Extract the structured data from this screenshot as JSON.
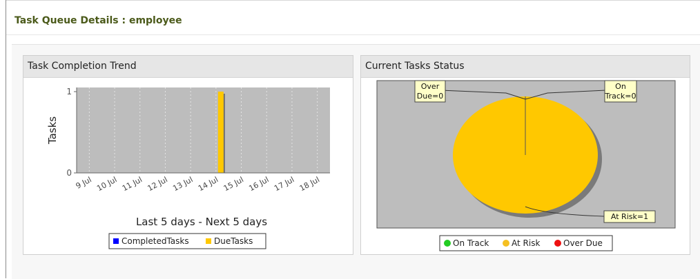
{
  "page": {
    "title": "Task Queue Details : employee"
  },
  "trend_panel": {
    "title": "Task Completion Trend",
    "legend": [
      {
        "label": "CompletedTasks",
        "color": "#0000ff"
      },
      {
        "label": "DueTasks",
        "color": "#ffc800"
      }
    ]
  },
  "status_panel": {
    "title": "Current Tasks Status",
    "callouts": {
      "over_due": [
        "Over",
        "Due=0"
      ],
      "on_track": [
        "On",
        "Track=0"
      ],
      "at_risk": "At Risk=1"
    },
    "legend": [
      {
        "label": "On Track",
        "color": "#22cc22"
      },
      {
        "label": "At Risk",
        "color": "#f5c022"
      },
      {
        "label": "Over Due",
        "color": "#ee1111"
      }
    ]
  },
  "chart_data": [
    {
      "type": "bar",
      "title": "",
      "xlabel": "Last 5 days - Next 5 days",
      "ylabel": "Tasks",
      "categories": [
        "9 Jul",
        "10 Jul",
        "11 Jul",
        "12 Jul",
        "13 Jul",
        "14 Jul",
        "15 Jul",
        "16 Jul",
        "17 Jul",
        "18 Jul"
      ],
      "ylim": [
        0,
        1
      ],
      "yticks": [
        "0",
        "1"
      ],
      "series": [
        {
          "name": "CompletedTasks",
          "color": "#0000ff",
          "values": [
            0,
            0,
            0,
            0,
            0,
            0,
            0,
            0,
            0,
            0
          ]
        },
        {
          "name": "DueTasks",
          "color": "#ffc800",
          "values": [
            0,
            0,
            0,
            0,
            0,
            1,
            0,
            0,
            0,
            0
          ]
        }
      ],
      "grid": true,
      "legend": "bottom"
    },
    {
      "type": "pie",
      "title": "",
      "slices": [
        {
          "name": "On Track",
          "value": 0,
          "color": "#22cc22"
        },
        {
          "name": "At Risk",
          "value": 1,
          "color": "#ffc800"
        },
        {
          "name": "Over Due",
          "value": 0,
          "color": "#ee1111"
        }
      ],
      "legend": "bottom"
    }
  ]
}
